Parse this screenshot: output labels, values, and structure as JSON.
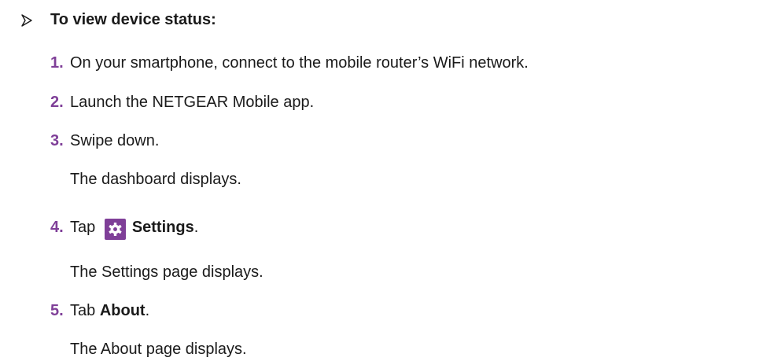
{
  "heading": "To view device status:",
  "steps": [
    {
      "number": "1.",
      "text": "On your smartphone, connect to the mobile router’s WiFi network."
    },
    {
      "number": "2.",
      "text": "Launch the NETGEAR Mobile app."
    },
    {
      "number": "3.",
      "text": "Swipe down.",
      "note": "The dashboard displays."
    },
    {
      "number": "4.",
      "prefix": "Tap",
      "icon": "settings-gear-icon",
      "bold": "Settings",
      "suffix": ".",
      "note": "The Settings page displays."
    },
    {
      "number": "5.",
      "prefix": "Tab",
      "bold": "About",
      "suffix": ".",
      "note": "The About page displays."
    }
  ],
  "colors": {
    "accent": "#7f3f98",
    "text": "#1a1a1a"
  }
}
